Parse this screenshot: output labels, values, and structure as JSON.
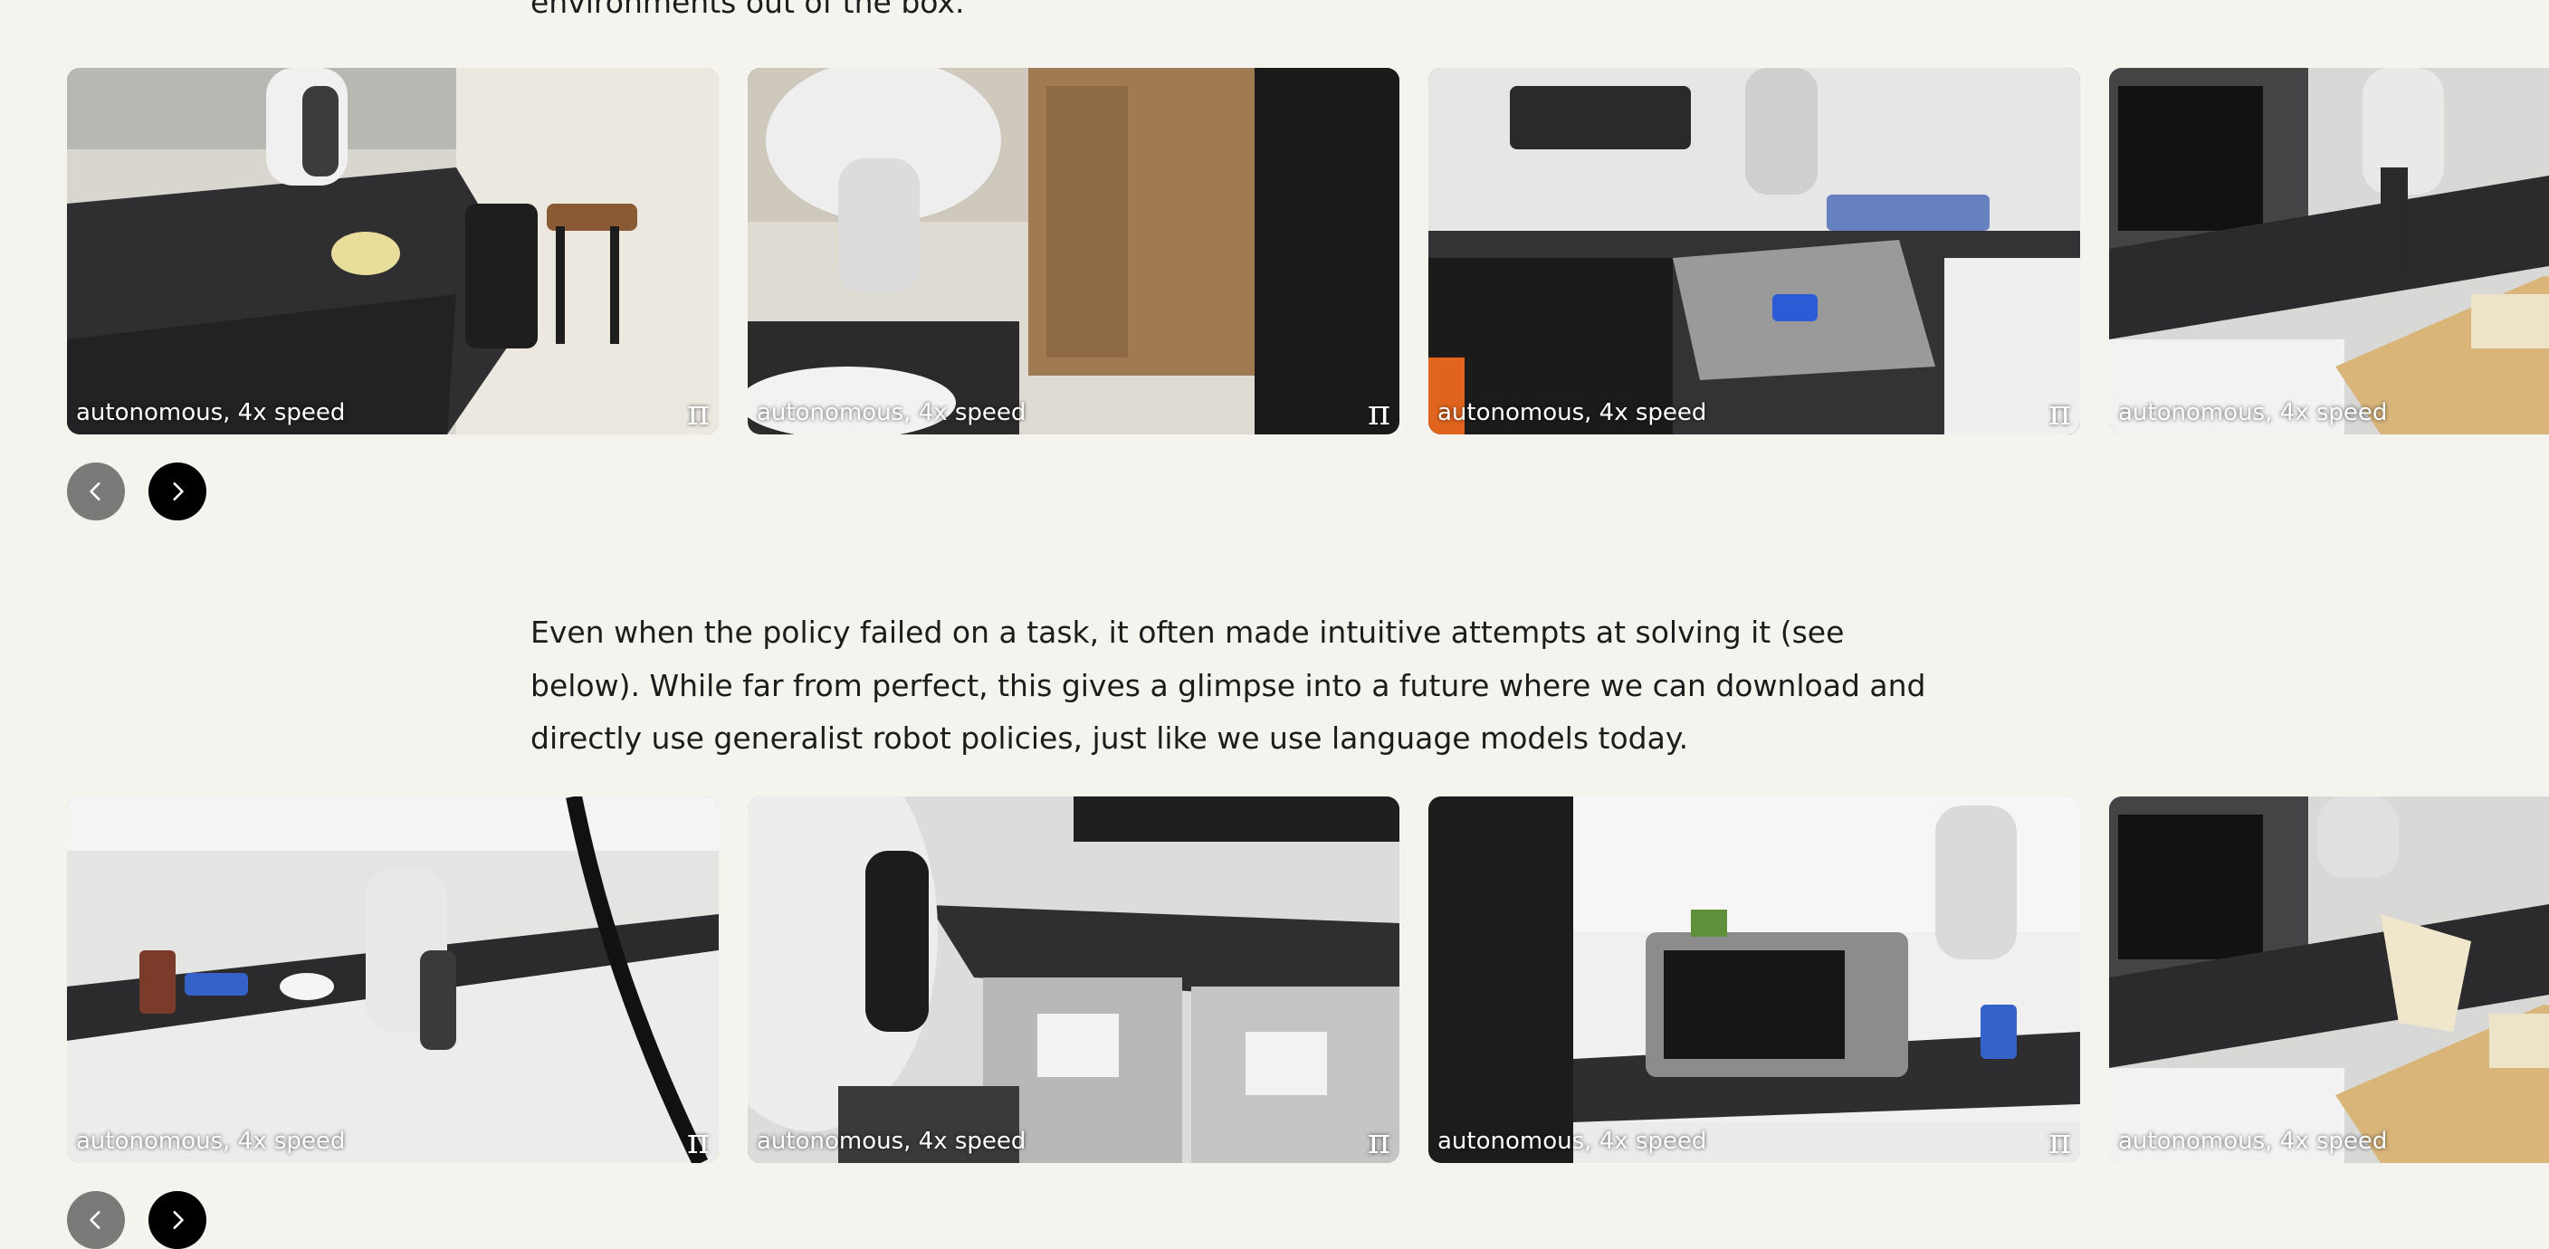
{
  "paragraphs": {
    "top_tail": "environments out of the box.",
    "failure_note": "Even when the policy failed on a task, it often made intuitive attempts at solving it (see below). While far from perfect, this gives a glimpse into a future where we can download and directly use generalist robot policies, just like we use language models today."
  },
  "carousel_success": {
    "videos": [
      {
        "caption": "autonomous, 4x speed",
        "badge": "π",
        "scene": "kitchen-island-chairs"
      },
      {
        "caption": "autonomous, 4x speed",
        "badge": "π",
        "scene": "pantry-cabinet"
      },
      {
        "caption": "autonomous, 4x speed",
        "badge": "π",
        "scene": "sink-dish-rack"
      },
      {
        "caption": "autonomous, 4x speed",
        "badge": "π",
        "scene": "microwave-drawer"
      }
    ],
    "controls": {
      "prev_icon": "chevron-left-icon",
      "next_icon": "chevron-right-icon"
    }
  },
  "carousel_failure": {
    "videos": [
      {
        "caption": "autonomous, 4x speed",
        "badge": "π",
        "scene": "office-kitchen-counter"
      },
      {
        "caption": "autonomous, 4x speed",
        "badge": "π",
        "scene": "dishwasher"
      },
      {
        "caption": "autonomous, 4x speed",
        "badge": "π",
        "scene": "microwave-counter"
      },
      {
        "caption": "autonomous, 4x speed",
        "badge": "π",
        "scene": "microwave-drawer-towels"
      }
    ],
    "controls": {
      "prev_icon": "chevron-left-icon",
      "next_icon": "chevron-right-icon"
    }
  },
  "colors": {
    "page_bg": "#f4f3ee",
    "text": "#1c1c1c",
    "prev_button": "#7a7a78",
    "next_button": "#000000"
  }
}
